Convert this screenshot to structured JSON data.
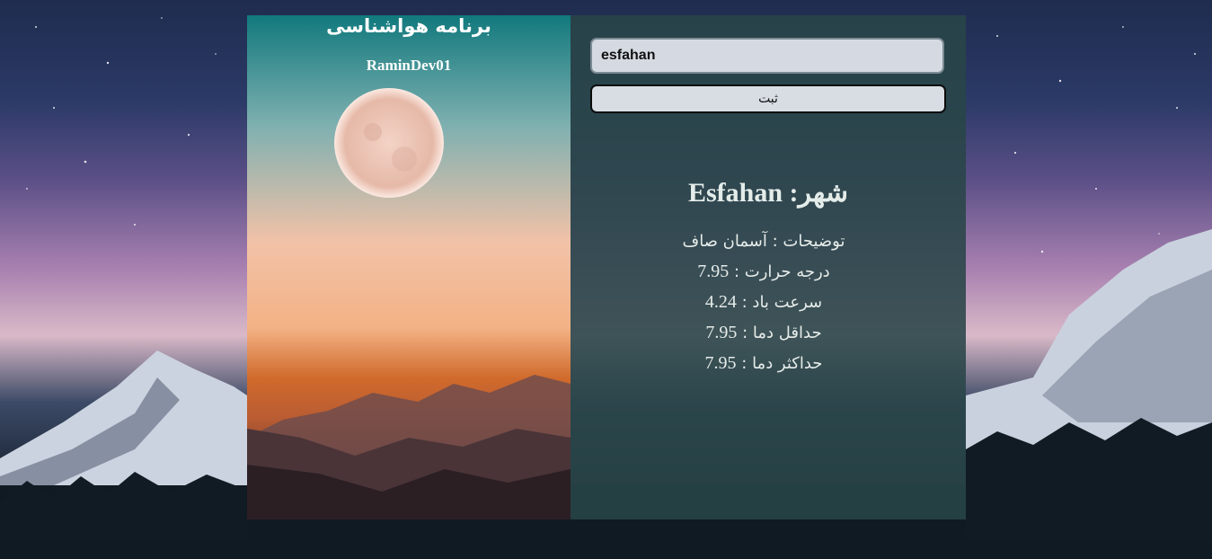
{
  "app": {
    "title": "برنامه هواشناسی",
    "author": "RaminDev01"
  },
  "search": {
    "value": "esfahan",
    "submit_label": "ثبت"
  },
  "weather": {
    "city_label": "شهر",
    "city_name": "Esfahan",
    "description_label": "توضیحات",
    "description_value": "آسمان صاف",
    "temperature_label": "درجه حرارت",
    "temperature_value": "7.95",
    "wind_label": "سرعت باد",
    "wind_value": "4.24",
    "min_temp_label": "حداقل دما",
    "min_temp_value": "7.95",
    "max_temp_label": "حداکثر دما",
    "max_temp_value": "7.95"
  },
  "colors": {
    "panel": "#294648",
    "input_bg": "#d5dae2",
    "text": "#e6ecea"
  }
}
